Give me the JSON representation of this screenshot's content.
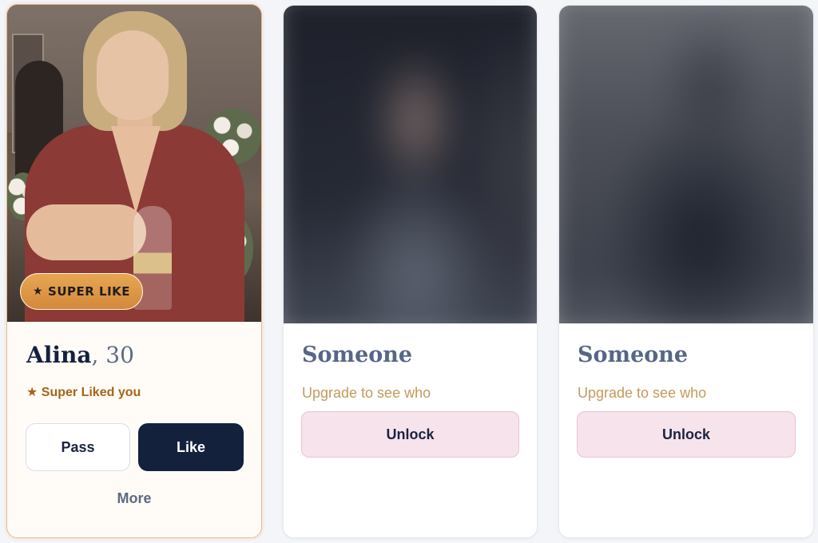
{
  "cards": {
    "featured": {
      "badge_label": "SUPER LIKE",
      "badge_icon": "star-icon",
      "name": "Alina",
      "age_text": ", 30",
      "super_text": "★ Super Liked you",
      "pass_label": "Pass",
      "like_label": "Like",
      "more_label": "More"
    },
    "locked": [
      {
        "title": "Someone",
        "subtitle": "Upgrade to see who",
        "unlock_label": "Unlock"
      },
      {
        "title": "Someone",
        "subtitle": "Upgrade to see who",
        "unlock_label": "Unlock"
      }
    ]
  },
  "colors": {
    "accent_navy": "#13213d",
    "super_orange": "#d3893a",
    "unlock_pink": "#f7e3ec",
    "background": "#f3f5f9"
  }
}
